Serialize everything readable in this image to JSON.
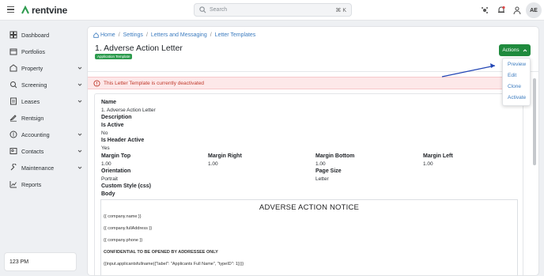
{
  "app": {
    "brand": "rentvine"
  },
  "header": {
    "search_placeholder": "Search",
    "search_shortcut": "⌘ K",
    "user_initials": "AE"
  },
  "sidebar": {
    "items": [
      {
        "label": "Dashboard",
        "icon": "dashboard-icon",
        "expandable": false
      },
      {
        "label": "Portfolios",
        "icon": "portfolios-icon",
        "expandable": false
      },
      {
        "label": "Property",
        "icon": "property-icon",
        "expandable": true
      },
      {
        "label": "Screening",
        "icon": "screening-icon",
        "expandable": true
      },
      {
        "label": "Leases",
        "icon": "leases-icon",
        "expandable": true
      },
      {
        "label": "Rentsign",
        "icon": "rentsign-icon",
        "expandable": false
      },
      {
        "label": "Accounting",
        "icon": "accounting-icon",
        "expandable": true
      },
      {
        "label": "Contacts",
        "icon": "contacts-icon",
        "expandable": true
      },
      {
        "label": "Maintenance",
        "icon": "maintenance-icon",
        "expandable": true
      },
      {
        "label": "Reports",
        "icon": "reports-icon",
        "expandable": false
      }
    ],
    "footer_text": "123 PM"
  },
  "breadcrumb": [
    "Home",
    "Settings",
    "Letters and Messaging",
    "Letter Templates"
  ],
  "page": {
    "title": "1. Adverse Action Letter",
    "badge": "Application Template",
    "actions_label": "Actions",
    "alert_text": "This Letter Template is currently deactivated"
  },
  "actions_menu": [
    "Preview",
    "Edit",
    "Clone",
    "Activate"
  ],
  "details": {
    "name_label": "Name",
    "name_value": "1. Adverse Action Letter",
    "description_label": "Description",
    "is_active_label": "Is Active",
    "is_active_value": "No",
    "is_header_active_label": "Is Header Active",
    "is_header_active_value": "Yes",
    "margins": [
      {
        "label": "Margin Top",
        "value": "1.00"
      },
      {
        "label": "Margin Right",
        "value": "1.00"
      },
      {
        "label": "Margin Bottom",
        "value": "1.00"
      },
      {
        "label": "Margin Left",
        "value": "1.00"
      }
    ],
    "orientation_label": "Orientation",
    "orientation_value": "Portrait",
    "page_size_label": "Page Size",
    "page_size_value": "Letter",
    "custom_style_label": "Custom Style (css)",
    "body_label": "Body"
  },
  "letter_body": {
    "heading": "ADVERSE ACTION NOTICE",
    "lines": [
      "{{ company.name }}",
      "{{ company.fullAddress }}",
      "{{ company.phone }}",
      "CONFIDENTIAL TO BE OPENED BY ADDRESSEE ONLY",
      "{{input.applicantsfullname({\"label\": \"Applicants Full Name\", \"typeID\": 1})}}"
    ]
  },
  "colors": {
    "primary_green": "#1f8a3d",
    "link_blue": "#3b7bbf",
    "alert_bg": "#fde8e9",
    "alert_text": "#c0392b",
    "annotation_arrow": "#2447b5"
  }
}
